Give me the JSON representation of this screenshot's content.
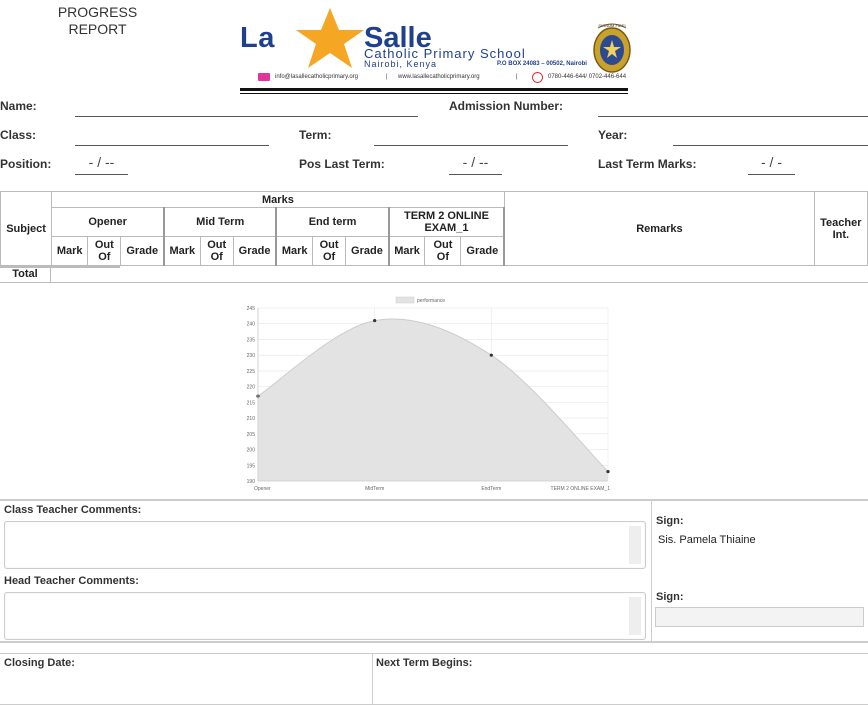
{
  "report": {
    "title_line1": "PROGRESS",
    "title_line2": "REPORT"
  },
  "school": {
    "name_part1": "La",
    "name_part2": "Salle",
    "subtitle": "Catholic Primary School",
    "city": "Nairobi, Kenya",
    "pobox": "P.O BOX 24083 – 00502, Nairobi",
    "email": "info@lasallecatholicprimary.org",
    "website": "www.lasallecatholicprimary.org",
    "phone": "0780-446-644/ 0702-446-644",
    "crest_text": "SIGNUM FIDEI",
    "brand_color": "#1f3f8f",
    "star_color": "#f5a623"
  },
  "student": {
    "name_label": "Name:",
    "admission_label": "Admission Number:",
    "class_label": "Class:",
    "term_label": "Term:",
    "year_label": "Year:",
    "position_label": "Position:",
    "position_value": "- / --",
    "pos_last_term_label": "Pos Last Term:",
    "pos_last_term_value": "- / --",
    "last_term_marks_label": "Last Term Marks:",
    "last_term_marks_value": "- / -"
  },
  "table": {
    "subject": "Subject",
    "marks": "Marks",
    "remarks": "Remarks",
    "teacher": "Teacher Int.",
    "total": "Total",
    "groups": [
      "Opener",
      "Mid Term",
      "End term",
      "TERM 2 ONLINE EXAM_1"
    ],
    "sub_mark": "Mark",
    "sub_outof": "Out Of",
    "sub_grade": "Grade"
  },
  "chart_data": {
    "type": "area",
    "legend": [
      "performance"
    ],
    "categories": [
      "Opener",
      "MidTerm",
      "EndTerm",
      "TERM 2 ONLINE EXAM_1"
    ],
    "series": [
      {
        "name": "performance",
        "values": [
          217,
          241,
          230,
          193
        ]
      }
    ],
    "ylim": [
      190,
      245
    ],
    "yticks": [
      190,
      195,
      200,
      205,
      210,
      215,
      220,
      225,
      230,
      235,
      240,
      245
    ],
    "grid": true,
    "legend_position": "top",
    "fill_color": "#e3e3e3",
    "line_color": "#cccccc"
  },
  "comments": {
    "class_teacher_label": "Class Teacher Comments:",
    "head_teacher_label": "Head Teacher Comments:",
    "sign_label": "Sign:",
    "class_teacher_sign_name": "Sis. Pamela Thiaine",
    "head_sign_label": "Sign:"
  },
  "footer": {
    "closing_label": "Closing Date:",
    "next_term_label": "Next Term Begins:"
  }
}
